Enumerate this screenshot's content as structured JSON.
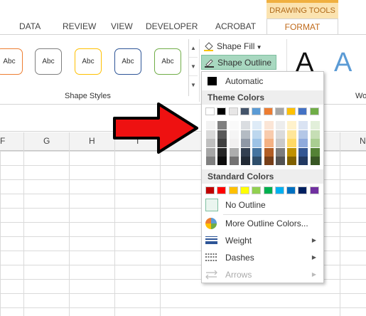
{
  "tabs": {
    "context_header": "DRAWING TOOLS",
    "items": [
      "DATA",
      "REVIEW",
      "VIEW",
      "DEVELOPER",
      "ACROBAT"
    ],
    "active": "FORMAT"
  },
  "ribbon": {
    "shape_style_label": "Abc",
    "shape_styles_group": "Shape Styles",
    "shape_fill": "Shape Fill",
    "shape_outline": "Shape Outline",
    "wordart_letter": "A",
    "wordart_group_partial": "Wo",
    "style_colors": [
      "#ed7d31",
      "#7f7f7f",
      "#ffc000",
      "#2e5597",
      "#70ad47"
    ]
  },
  "columns": [
    "F",
    "G",
    "H",
    "I",
    "N"
  ],
  "menu": {
    "automatic": "Automatic",
    "theme_colors_label": "Theme Colors",
    "theme_colors": [
      "#ffffff",
      "#000000",
      "#e7e6e6",
      "#44546a",
      "#5b9bd5",
      "#ed7d31",
      "#a5a5a5",
      "#ffc000",
      "#4472c4",
      "#70ad47"
    ],
    "standard_colors_label": "Standard Colors",
    "standard_colors": [
      "#c00000",
      "#ff0000",
      "#ffc000",
      "#ffff00",
      "#92d050",
      "#00b050",
      "#00b0f0",
      "#0070c0",
      "#002060",
      "#7030a0"
    ],
    "no_outline": "No Outline",
    "more_colors": "More Outline Colors...",
    "weight": "Weight",
    "dashes": "Dashes",
    "arrows": "Arrows"
  }
}
